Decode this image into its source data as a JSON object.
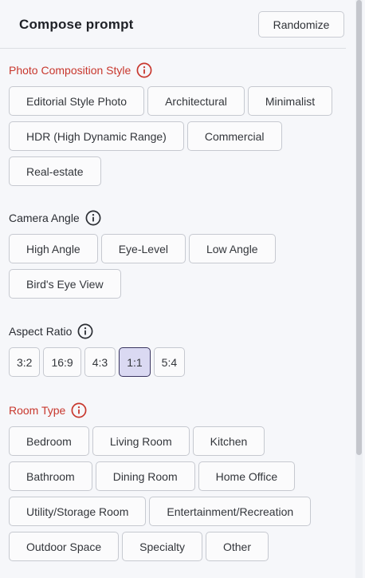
{
  "header": {
    "title": "Compose prompt",
    "randomize_label": "Randomize"
  },
  "sections": [
    {
      "title": "Photo Composition Style",
      "required": true,
      "options": [
        "Editorial Style Photo",
        "Architectural",
        "Minimalist",
        "HDR (High Dynamic Range)",
        "Commercial",
        "Real-estate"
      ],
      "selected": null
    },
    {
      "title": "Camera Angle",
      "required": false,
      "options": [
        "High Angle",
        "Eye-Level",
        "Low Angle",
        "Bird's Eye View"
      ],
      "selected": null
    },
    {
      "title": "Aspect Ratio",
      "required": false,
      "options": [
        "3:2",
        "16:9",
        "4:3",
        "1:1",
        "5:4"
      ],
      "selected": "1:1"
    },
    {
      "title": "Room Type",
      "required": true,
      "options": [
        "Bedroom",
        "Living Room",
        "Kitchen",
        "Bathroom",
        "Dining Room",
        "Home Office",
        "Utility/Storage Room",
        "Entertainment/Recreation",
        "Outdoor Space",
        "Specialty",
        "Other"
      ],
      "selected": null
    }
  ],
  "colors": {
    "required": "#c8372d",
    "selected_bg": "#dad9f2",
    "selected_border": "#3a3560",
    "chip_border": "#c6c9d0"
  },
  "icons": {
    "info": "info-circle-icon"
  }
}
